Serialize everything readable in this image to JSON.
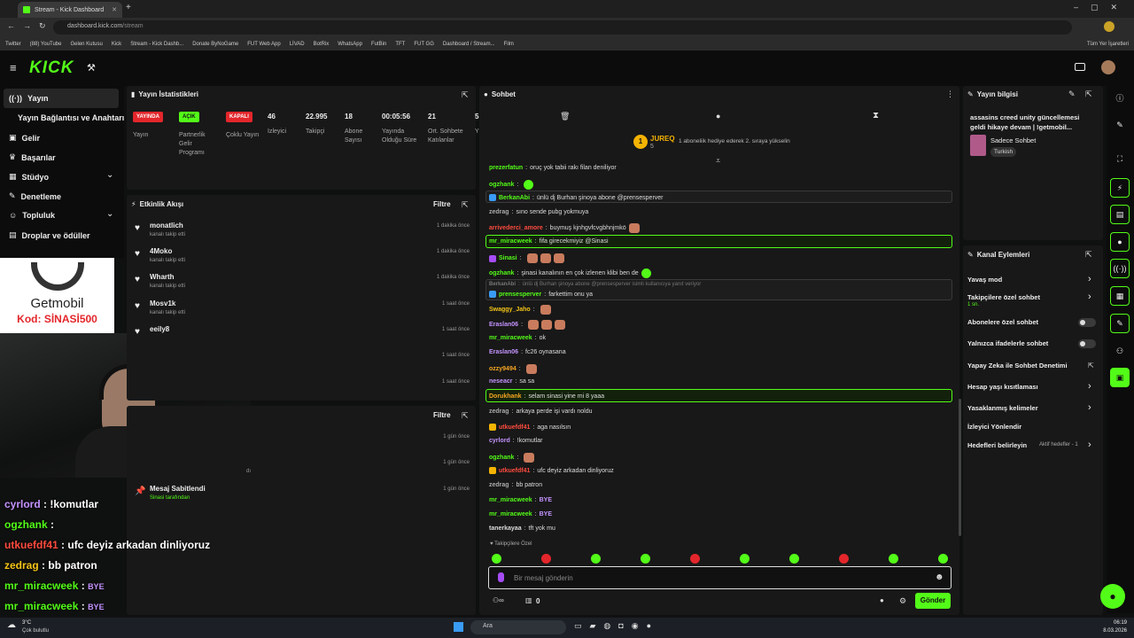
{
  "browser": {
    "tab_title": "Stream - Kick Dashboard",
    "url_host": "dashboard.kick.com",
    "url_path": "/stream",
    "bookmarks": [
      "Twitter",
      "(88) YouTube",
      "Gelen Kutusu",
      "Kick",
      "Stream - Kick Dashb...",
      "Donate ByNoGame",
      "FUT Web App",
      "LİVAD",
      "BotRix",
      "WhatsApp",
      "FutBin",
      "TFT",
      "FUT GG",
      "Dashboard / Stream...",
      "Film"
    ],
    "all_bookmarks": "Tüm Yer İşaretleri"
  },
  "app": {
    "logo": "KICK",
    "accent": "#53fc18"
  },
  "nav": {
    "items": [
      {
        "label": "Yayın",
        "icon": "broadcast-icon"
      },
      {
        "label": "Yayın Bağlantısı ve Anahtarı",
        "icon": ""
      },
      {
        "label": "Gelir",
        "icon": "money-icon"
      },
      {
        "label": "Başarılar",
        "icon": "trophy-icon"
      },
      {
        "label": "Stüdyo",
        "icon": "studio-icon"
      },
      {
        "label": "Denetleme",
        "icon": "wrench-icon"
      },
      {
        "label": "Topluluk",
        "icon": "people-icon"
      },
      {
        "label": "Droplar ve ödüller",
        "icon": "gift-icon"
      }
    ]
  },
  "sponsor": {
    "brand": "Getmobil",
    "code": "Kod: SİNASİ500"
  },
  "overlay_chat": [
    {
      "user": "cyrlord",
      "text": "!komutlar",
      "color": "#c493ff"
    },
    {
      "user": "ogzhank",
      "text": "",
      "color": "#53fc18"
    },
    {
      "user": "utkuefdf41",
      "text": "ufc deyiz arkadan dinliyoruz",
      "color": "#ff4b3e"
    },
    {
      "user": "zedrag",
      "text": "bb patron",
      "color": "#f5c518"
    },
    {
      "user": "mr_miracweek",
      "text": "BYE",
      "color": "#53fc18"
    },
    {
      "user": "mr_miracweek",
      "text": "BYE",
      "color": "#53fc18"
    }
  ],
  "stats": {
    "title": "Yayın İstatistikleri",
    "badges": [
      {
        "label": "YAYINDA",
        "desc": "Yayın",
        "color": "#e3262b"
      },
      {
        "label": "AÇIK",
        "desc": "Partnerlik Gelir Programı",
        "color": "#53fc18"
      },
      {
        "label": "KAPALI",
        "desc": "Çoklu Yayın",
        "color": "#e3262b"
      }
    ],
    "metrics": [
      {
        "value": "46",
        "label": "İzleyici"
      },
      {
        "value": "22.995",
        "label": "Takipçi"
      },
      {
        "value": "18",
        "label": "Abone Sayısı"
      },
      {
        "value": "00:05:56",
        "label": "Yayında Olduğu Süre"
      },
      {
        "value": "21",
        "label": "Ort. Sohbete Katılanlar"
      },
      {
        "value": "5",
        "label": "Y"
      }
    ]
  },
  "activity": {
    "title": "Etkinlik Akışı",
    "filter": "Filtre",
    "items": [
      {
        "name": "monatlich",
        "sub": "kanalı takip etti",
        "time": "1 dakika önce"
      },
      {
        "name": "4Moko",
        "sub": "kanalı takip etti",
        "time": "1 dakika önce"
      },
      {
        "name": "Wharth",
        "sub": "kanalı takip etti",
        "time": "1 dakika önce"
      },
      {
        "name": "Mosv1k",
        "sub": "kanalı takip etti",
        "time": "1 saat önce"
      },
      {
        "name": "eeily8",
        "sub": "",
        "time": "1 saat önce"
      },
      {
        "name": "",
        "sub": "",
        "time": "1 saat önce"
      },
      {
        "name": "",
        "sub": "",
        "time": "1 saat önce"
      }
    ]
  },
  "events2": {
    "filter": "Filtre",
    "items": [
      {
        "name": "",
        "sub": "",
        "time": "1 gün önce"
      },
      {
        "name": "",
        "sub": "dı",
        "time": "1 gün önce"
      },
      {
        "name": "Mesaj Sabitlendi",
        "sub": "Sinasi tarafından",
        "time": "1 gün önce"
      }
    ]
  },
  "chat": {
    "title": "Sohbet",
    "top_user": "JUREQ",
    "top_count": "5",
    "top_text": "1 aboneliik hediye ederek 2. sıraya yükselin",
    "messages": [
      {
        "user": "prezerfatun",
        "text": "oruç yok tabii rakı filan deniliyor",
        "color": "#53fc18"
      },
      {
        "user": "ogzhank",
        "text": "",
        "color": "#53fc18"
      },
      {
        "user": "BerkanAbi",
        "text": "ünlü dj Burhan şinoya abone @prensesperver",
        "color": "#53fc18"
      },
      {
        "user": "zedrag",
        "text": "sıno sende pubg yokmuya",
        "color": "#aaaaaa"
      },
      {
        "user": "arrivederci_amore",
        "text": "buymuş kjnhgvfcvgbhnjmkö",
        "color": "#ff4b3e"
      },
      {
        "user": "mr_miracweek",
        "text": "fifa girecekmiyiz @Sinasi",
        "color": "#53fc18"
      },
      {
        "user": "Sinasi",
        "text": "",
        "color": "#53fc18"
      },
      {
        "user": "ogzhank",
        "text": "şinasi kanalının en çok izlenen klibi ben de",
        "color": "#53fc18"
      },
      {
        "user": "BerkanAbi",
        "text": "ünlü dj Burhan şinoya abone @prensesperver isimli kullanıcıya yanıt veriyor",
        "color": "#777777"
      },
      {
        "user": "prensesperver",
        "text": "farkettim onu ya",
        "color": "#53fc18"
      },
      {
        "user": "Swaggy_Jaho",
        "text": "",
        "color": "#f5c518"
      },
      {
        "user": "Eraslan06",
        "text": "",
        "color": "#c493ff"
      },
      {
        "user": "mr_miracweek",
        "text": "ok",
        "color": "#53fc18"
      },
      {
        "user": "Eraslan06",
        "text": "fc26 oynasana",
        "color": "#c493ff"
      },
      {
        "user": "ozzy9494",
        "text": "",
        "color": "#f5a623"
      },
      {
        "user": "neseacr",
        "text": "sa sa",
        "color": "#c493ff"
      },
      {
        "user": "Dorukhank",
        "text": "selam sinasi yine mi 8 yaaa",
        "color": "#f5a623"
      },
      {
        "user": "zedrag",
        "text": "arkaya perde işi vardı noldu",
        "color": "#aaaaaa"
      },
      {
        "user": "utkuefdf41",
        "text": "aga nasılsın",
        "color": "#ff4b3e"
      },
      {
        "user": "cyrlord",
        "text": "!komutlar",
        "color": "#c493ff"
      },
      {
        "user": "ogzhank",
        "text": "",
        "color": "#53fc18"
      },
      {
        "user": "utkuefdf41",
        "text": "ufc deyiz arkadan dinliyoruz",
        "color": "#ff4b3e"
      },
      {
        "user": "zedrag",
        "text": "bb patron",
        "color": "#aaaaaa"
      },
      {
        "user": "mr_miracweek",
        "text": "BYE",
        "color": "#53fc18"
      },
      {
        "user": "mr_miracweek",
        "text": "BYE",
        "color": "#53fc18"
      },
      {
        "user": "tanerkayaa",
        "text": "tft yok mu",
        "color": "#dddddd"
      }
    ],
    "followers_only": "Takipçilere Özel",
    "input_placeholder": "Bir mesaj gönderin",
    "count": "0",
    "send": "Gönder"
  },
  "stream_info": {
    "title": "Yayın bilgisi",
    "stream_title": "assasins creed unity güncellemesi geldi hikaye devam | !getmobil...",
    "category": "Sadece Sohbet",
    "language": "Turkish"
  },
  "channel_actions": {
    "title": "Kanal Eylemleri",
    "items": [
      {
        "label": "Yavaş mod",
        "sub": "",
        "type": "chevron"
      },
      {
        "label": "Takipçilere özel sohbet",
        "sub": "1 sn.",
        "type": "chevron"
      },
      {
        "label": "Abonelere özel sohbet",
        "sub": "",
        "type": "toggle"
      },
      {
        "label": "Yalnızca ifadelerle sohbet",
        "sub": "",
        "type": "toggle"
      },
      {
        "label": "Yapay Zeka ile Sohbet Denetimi",
        "sub": "",
        "type": "link"
      },
      {
        "label": "Hesap yaşı kısıtlaması",
        "sub": "",
        "type": "chevron"
      },
      {
        "label": "Yasaklanmış kelimeler",
        "sub": "",
        "type": "chevron"
      },
      {
        "label": "İzleyici Yönlendir",
        "sub": "",
        "type": "none"
      },
      {
        "label": "Hedefleri belirleyin",
        "sub": "Aktif hedefler - 1",
        "type": "chevron"
      }
    ]
  },
  "taskbar": {
    "weather": "3°C",
    "weather_desc": "Çok bulutlu",
    "search": "Ara",
    "time": "06:19",
    "date": "8.03.2026"
  }
}
